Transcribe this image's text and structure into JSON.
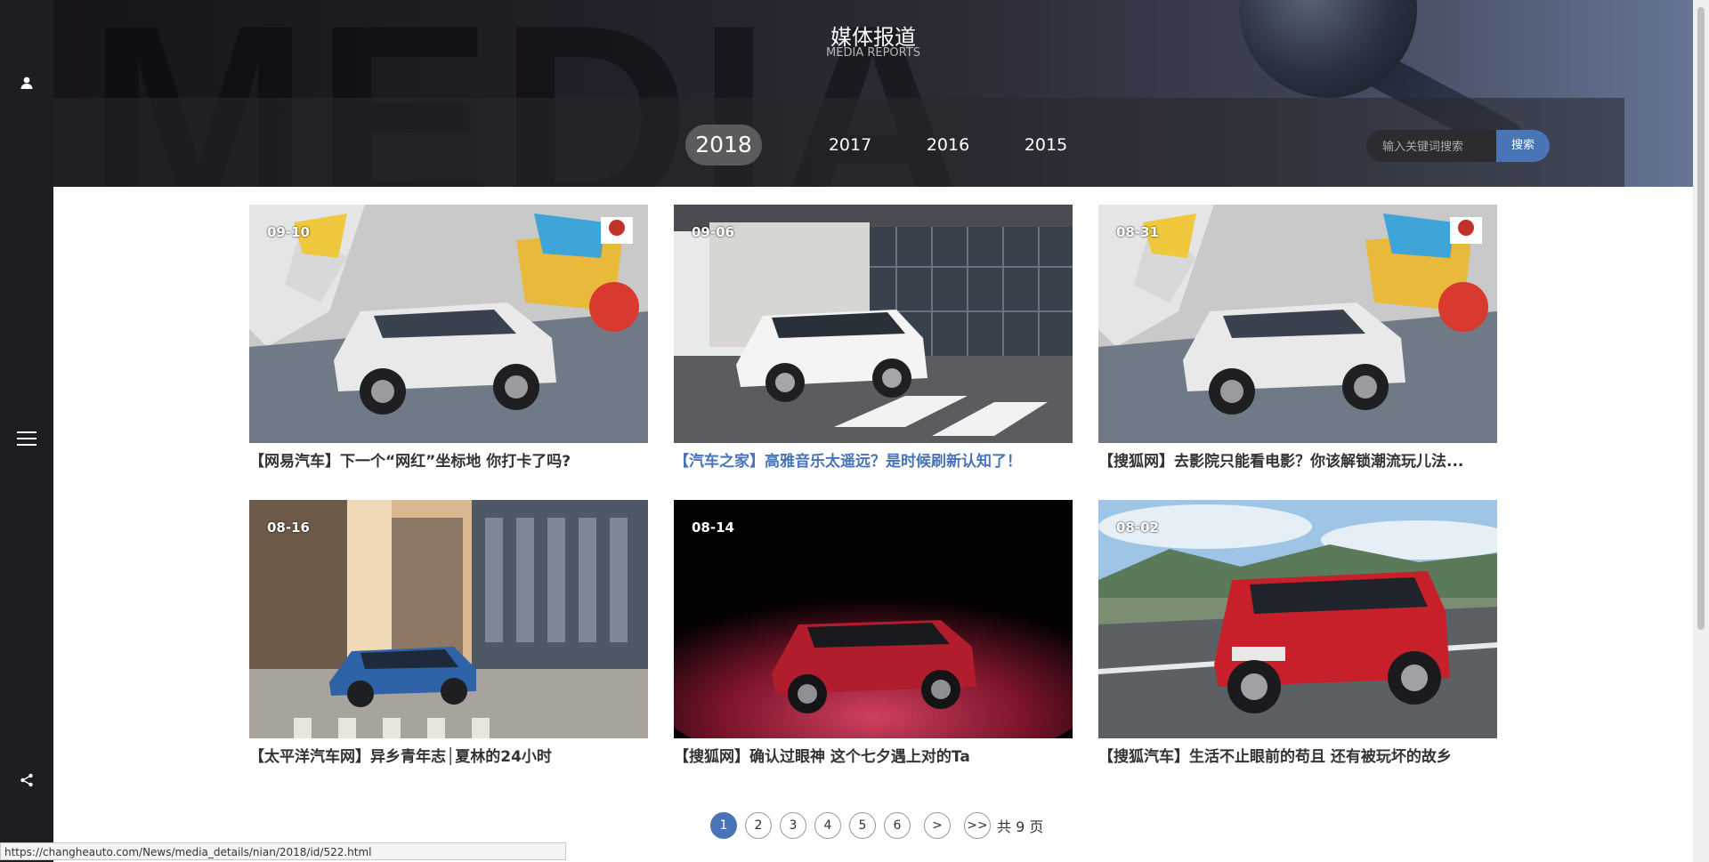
{
  "sidebar": {
    "top_icon": "user-icon",
    "middle_icon": "menu-icon",
    "bottom_icon": "share-icon"
  },
  "hero": {
    "title": "媒体报道",
    "subtitle": "MEDIA REPORTS",
    "background_word": "MEDIA"
  },
  "years": [
    "2018",
    "2017",
    "2016",
    "2015"
  ],
  "active_year": "2018",
  "search": {
    "placeholder": "输入关键词搜索",
    "button_label": "搜索"
  },
  "cards": [
    {
      "date": "09-10",
      "title": "【网易汽车】下一个“网红”坐标地 你打卡了吗?",
      "image": "suv-graffiti-wall"
    },
    {
      "date": "09-06",
      "title": "【汽车之家】高雅音乐太遥远？是时候刷新认知了！",
      "image": "suv-modern-building"
    },
    {
      "date": "08-31",
      "title": "【搜狐网】去影院只能看电影？你该解锁潮流玩儿法...",
      "image": "suv-graffiti-wall"
    },
    {
      "date": "08-16",
      "title": "【太平洋汽车网】异乡青年志│夏林的24小时",
      "image": "blue-suv-city"
    },
    {
      "date": "08-14",
      "title": "【搜狐网】确认过眼神 这个七夕遇上对的Ta",
      "image": "red-suv-smoke"
    },
    {
      "date": "08-02",
      "title": "【搜狐汽车】生活不止眼前的苟且 还有被玩坏的故乡",
      "image": "red-suv-road"
    }
  ],
  "pagination": {
    "pages": [
      "1",
      "2",
      "3",
      "4",
      "5",
      "6"
    ],
    "current": "1",
    "next": ">",
    "last": ">>",
    "total_text": "共 9 页"
  },
  "status_url": "https://changheauto.com/News/media_details/nian/2018/id/522.html",
  "colors": {
    "accent": "#4a74b8",
    "sidebar": "#1e1d22",
    "highlight_title": "#4a74b8"
  }
}
